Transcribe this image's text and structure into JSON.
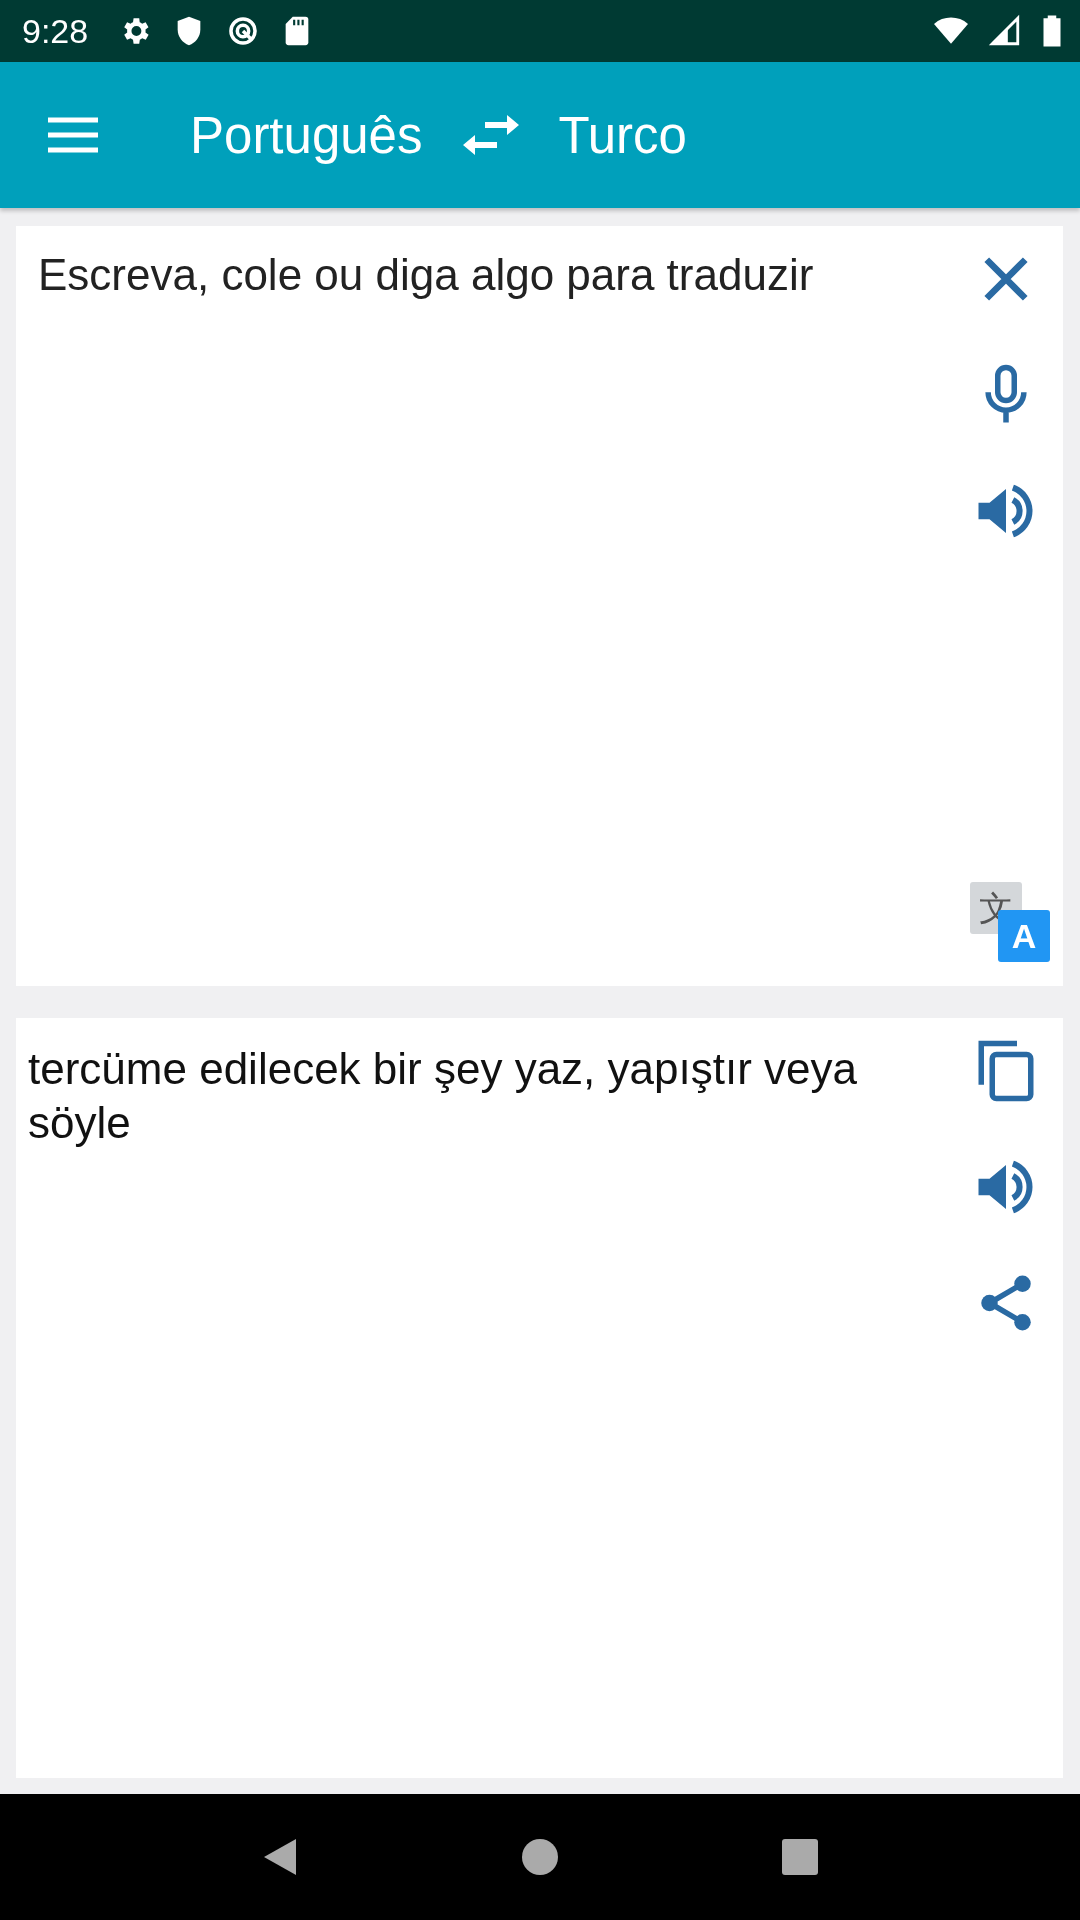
{
  "status_bar": {
    "time": "9:28"
  },
  "toolbar": {
    "source_language": "Português",
    "target_language": "Turco"
  },
  "input_panel": {
    "placeholder": "Escreva, cole ou diga algo para traduzir",
    "translate_icon": {
      "source_glyph": "文",
      "target_glyph": "A"
    }
  },
  "output_panel": {
    "text": "tercüme edilecek bir şey yaz, yapıştır veya söyle"
  }
}
